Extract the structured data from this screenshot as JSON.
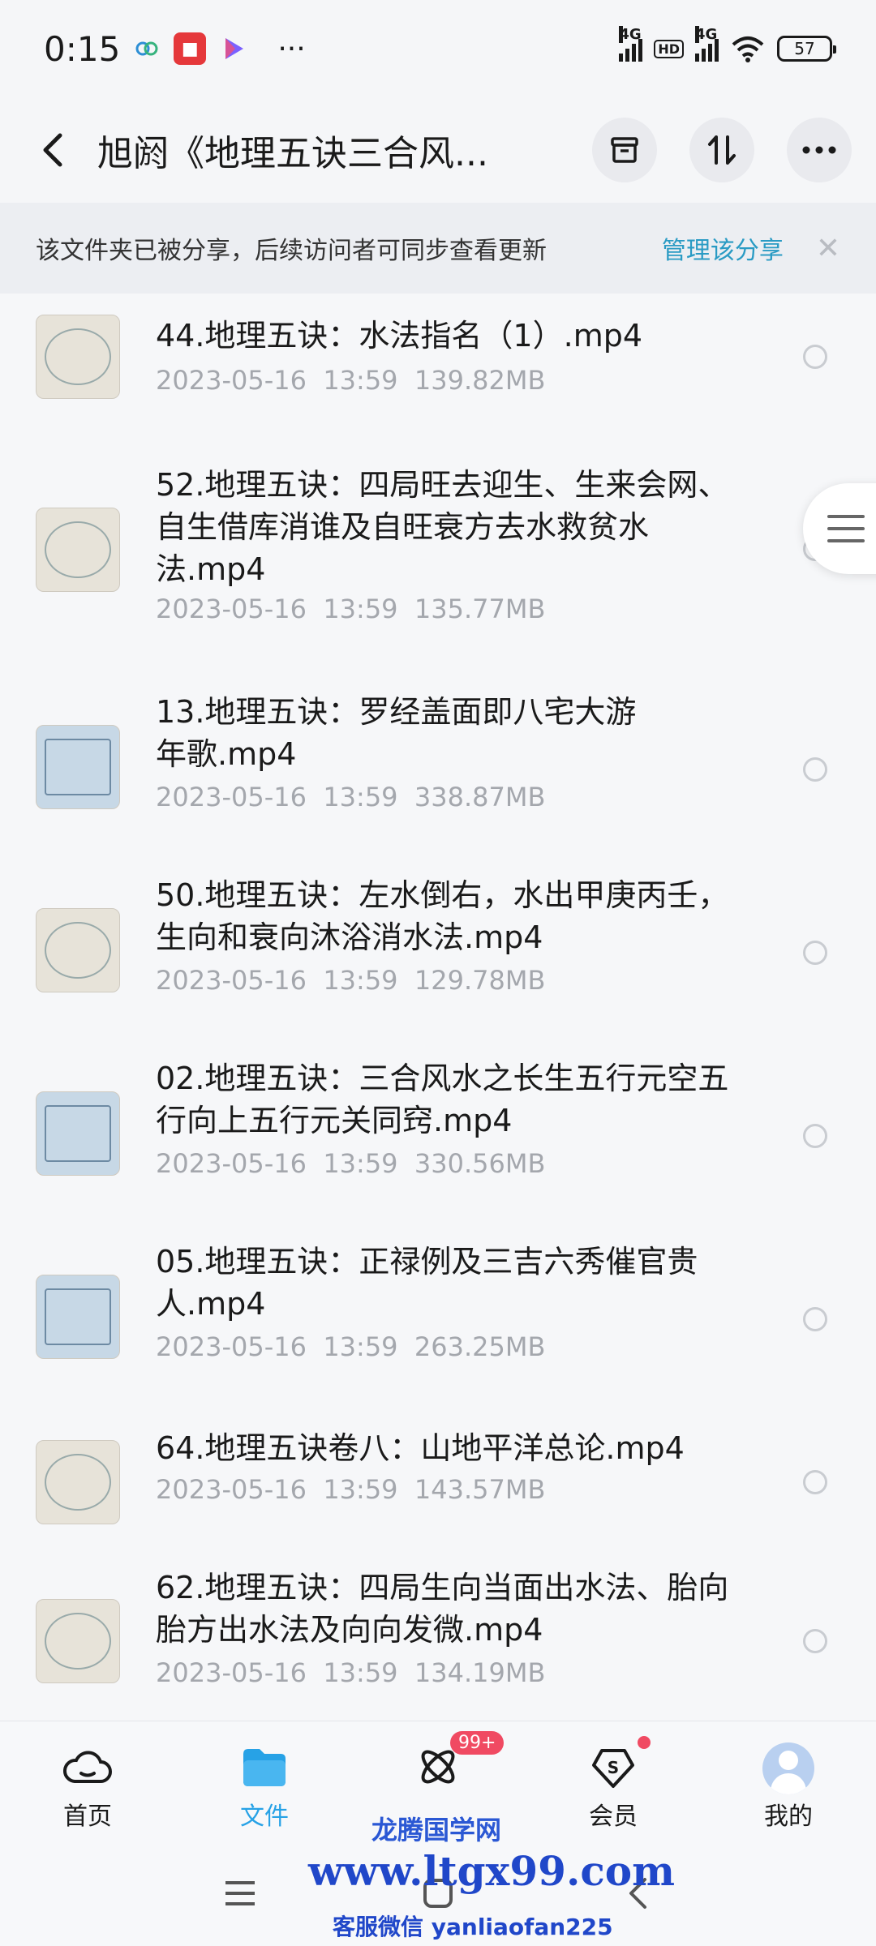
{
  "status": {
    "time": "0:15",
    "dots": "···",
    "net1": "4G",
    "hd": "HD",
    "net2": "4G",
    "battery": "57"
  },
  "header": {
    "title": "旭阏《地理五诀三合风..."
  },
  "banner": {
    "text": "该文件夹已被分享，后续访问者可同步查看更新",
    "link": "管理该分享"
  },
  "files": [
    {
      "name": "44.地理五诀：水法指名（1）.mp4",
      "date": "2023-05-16",
      "time": "13:59",
      "size": "139.82MB"
    },
    {
      "name": "52.地理五诀：四局旺去迎生、生来会网、自生借库消谁及自旺衰方去水救贫水法.mp4",
      "date": "2023-05-16",
      "time": "13:59",
      "size": "135.77MB"
    },
    {
      "name": "13.地理五诀：罗经盖面即八宅大游年歌.mp4",
      "date": "2023-05-16",
      "time": "13:59",
      "size": "338.87MB"
    },
    {
      "name": "50.地理五诀：左水倒右，水出甲庚丙壬，生向和衰向沐浴消水法.mp4",
      "date": "2023-05-16",
      "time": "13:59",
      "size": "129.78MB"
    },
    {
      "name": "02.地理五诀：三合风水之长生五行元空五行向上五行元关同窍.mp4",
      "date": "2023-05-16",
      "time": "13:59",
      "size": "330.56MB"
    },
    {
      "name": "05.地理五诀：正禄例及三吉六秀催官贵人.mp4",
      "date": "2023-05-16",
      "time": "13:59",
      "size": "263.25MB"
    },
    {
      "name": "64.地理五诀卷八：山地平洋总论.mp4",
      "date": "2023-05-16",
      "time": "13:59",
      "size": "143.57MB"
    },
    {
      "name": "62.地理五诀：四局生向当面出水法、胎向胎方出水法及向向发微.mp4",
      "date": "2023-05-16",
      "time": "13:59",
      "size": "134.19MB"
    }
  ],
  "nav": {
    "home": "首页",
    "files": "文件",
    "share_badge": "99+",
    "member": "会员",
    "mine": "我的"
  },
  "watermark": {
    "line1": "龙腾国学网",
    "line2": "www.ltgx99.com",
    "line3": "客服微信 yanliaofan225"
  },
  "colors": {
    "accent": "#27a2e6",
    "link": "#2a9bc4",
    "badge": "#f04a62"
  }
}
